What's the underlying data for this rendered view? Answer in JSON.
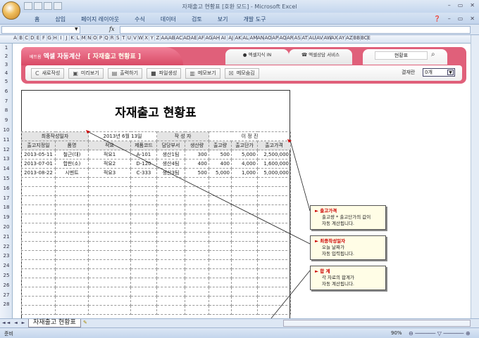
{
  "window": {
    "title": "자재출고 현황표 [호환 모드] - Microsoft Excel"
  },
  "ribbon": {
    "tabs": [
      "홈",
      "삽입",
      "페이지 레이아웃",
      "수식",
      "데이터",
      "검토",
      "보기",
      "개발 도구"
    ]
  },
  "formula_bar": {
    "fx": "fx",
    "name_box": "",
    "value": ""
  },
  "columns": [
    "A",
    "B",
    "C",
    "D",
    "E",
    "F",
    "G",
    "H",
    "I",
    "J",
    "K",
    "L",
    "M",
    "N",
    "O",
    "P",
    "Q",
    "R",
    "S",
    "T",
    "U",
    "V",
    "W",
    "X",
    "Y",
    "Z",
    "AA",
    "AB",
    "AC",
    "AD",
    "AE",
    "AF",
    "AG",
    "AH",
    "AI",
    "AJ",
    "AK",
    "AL",
    "AM",
    "AN",
    "AO",
    "AP",
    "AQ",
    "AR",
    "AS",
    "AT",
    "AU",
    "AV",
    "AW",
    "AX",
    "AY",
    "AZ",
    "BB",
    "BCE"
  ],
  "banner": {
    "brand_small": "베트욤",
    "brand": "엑셀 자동계산",
    "subtitle": "[ 자재출고 현황표 ]",
    "tab1": "엑셀지식 IN",
    "tab2": "엑셀상담 서비스",
    "search_value": "현황표",
    "buttons": [
      "새로작성",
      "미리보기",
      "출력하기",
      "파일생성",
      "메모보기",
      "메모숨김"
    ],
    "approval_label": "결재란",
    "approval_value": "0개"
  },
  "report": {
    "title": "자재출고 현황표",
    "last_date_label": "최종작성일자",
    "last_date": "2013년 6월 13일",
    "author_label": "작 성 자",
    "author": "이 정 진",
    "headers": [
      "출고지정일",
      "품명",
      "적요",
      "제품코드",
      "담당부서",
      "생산량",
      "출고량",
      "출고단가",
      "출고가격"
    ],
    "rows": [
      [
        "2013-05-11",
        "철근(대)",
        "적요1",
        "A-101",
        "생산1팀",
        "300",
        "500",
        "5,000",
        "2,500,000"
      ],
      [
        "2013-07-01",
        "합판(소)",
        "적요2",
        "D-120",
        "생산4팀",
        "400",
        "400",
        "4,000",
        "1,600,000"
      ],
      [
        "2013-08-22",
        "시멘트",
        "적요3",
        "C-333",
        "생산3팀",
        "500",
        "5,000",
        "1,000",
        "5,000,000"
      ]
    ]
  },
  "callouts": [
    {
      "title": "출고가격",
      "line1": "출고량 * 출고단가의 값이",
      "line2": "자동 계산됩니다."
    },
    {
      "title": "최종작성일자",
      "line1": "오늘 날짜가",
      "line2": "자동 입력됩니다."
    },
    {
      "title": "합    계",
      "line1": "각 자료의 합계가",
      "line2": "자동 계산됩니다."
    }
  ],
  "sheet_tab": "자재출고 현황표",
  "status": {
    "ready": "준비",
    "zoom": "90%"
  }
}
